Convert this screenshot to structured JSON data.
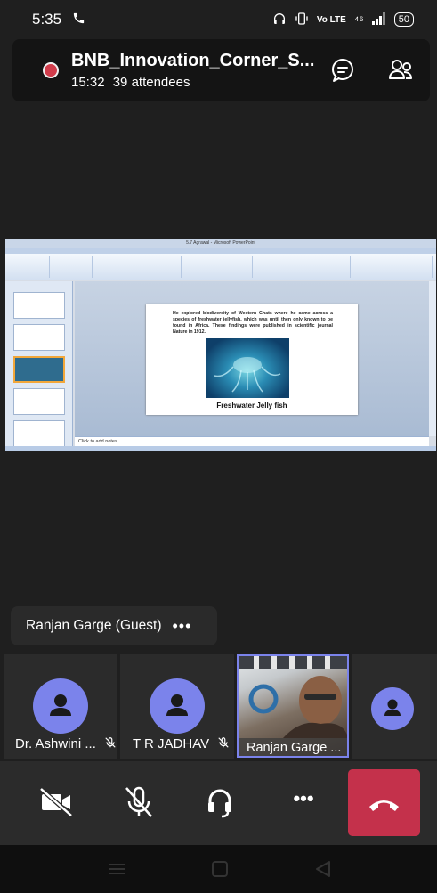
{
  "status_bar": {
    "time": "5:35",
    "network": "⁴⁶",
    "battery": "50"
  },
  "meeting": {
    "title": "BNB_Innovation_Corner_S...",
    "duration": "15:32",
    "attendees": "39 attendees"
  },
  "shared_screen": {
    "window_title": "5.7 Agrawal - Microsoft PowerPoint",
    "slide_text": "He explored biodiversity of Western Ghats where he came across a species of freshwater jellyfish, which was until then only known to be found in Africa. These findings were published in scientific journal Nature in 1912.",
    "slide_caption": "Freshwater Jelly fish",
    "notes_placeholder": "Click to add notes"
  },
  "active_speaker": {
    "name": "Ranjan Garge (Guest)",
    "more_label": "•••"
  },
  "participants": [
    {
      "name": "Dr. Ashwini ...",
      "muted": true
    },
    {
      "name": "T R JADHAV",
      "muted": true
    },
    {
      "name": "Ranjan Garge ...",
      "muted": false
    },
    {
      "name": "",
      "muted": false
    }
  ],
  "controls": {
    "more_label": "•••"
  },
  "colors": {
    "avatar": "#7b83eb",
    "hangup": "#c4314b",
    "recording": "#d13c4b"
  }
}
